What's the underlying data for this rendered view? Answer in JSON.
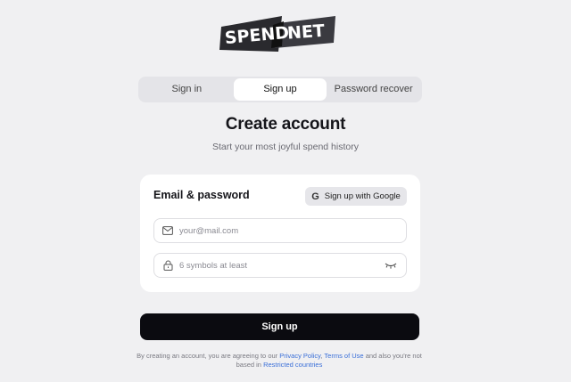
{
  "brand": {
    "logo_left": "SPEND",
    "logo_right": "NET"
  },
  "tabs": [
    {
      "label": "Sign in",
      "active": false
    },
    {
      "label": "Sign up",
      "active": true
    },
    {
      "label": "Password recover",
      "active": false
    }
  ],
  "header": {
    "title": "Create account",
    "subtitle": "Start your most joyful spend history"
  },
  "form": {
    "section_title": "Email & password",
    "google_button_label": "Sign up with Google",
    "email_placeholder": "your@mail.com",
    "email_value": "",
    "password_placeholder": "6 symbols at least",
    "password_value": "",
    "submit_label": "Sign up"
  },
  "legal": {
    "text_before": "By creating an account, you are agreeing to our ",
    "privacy_link": "Privacy Policy",
    "comma": ", ",
    "terms_link": "Terms of Use",
    "text_middle": " and also you're not based in ",
    "restricted_link": "Restricted countries"
  },
  "colors": {
    "background": "#f0f0f2",
    "primary_button": "#0b0b10",
    "link": "#3a6fd8"
  }
}
